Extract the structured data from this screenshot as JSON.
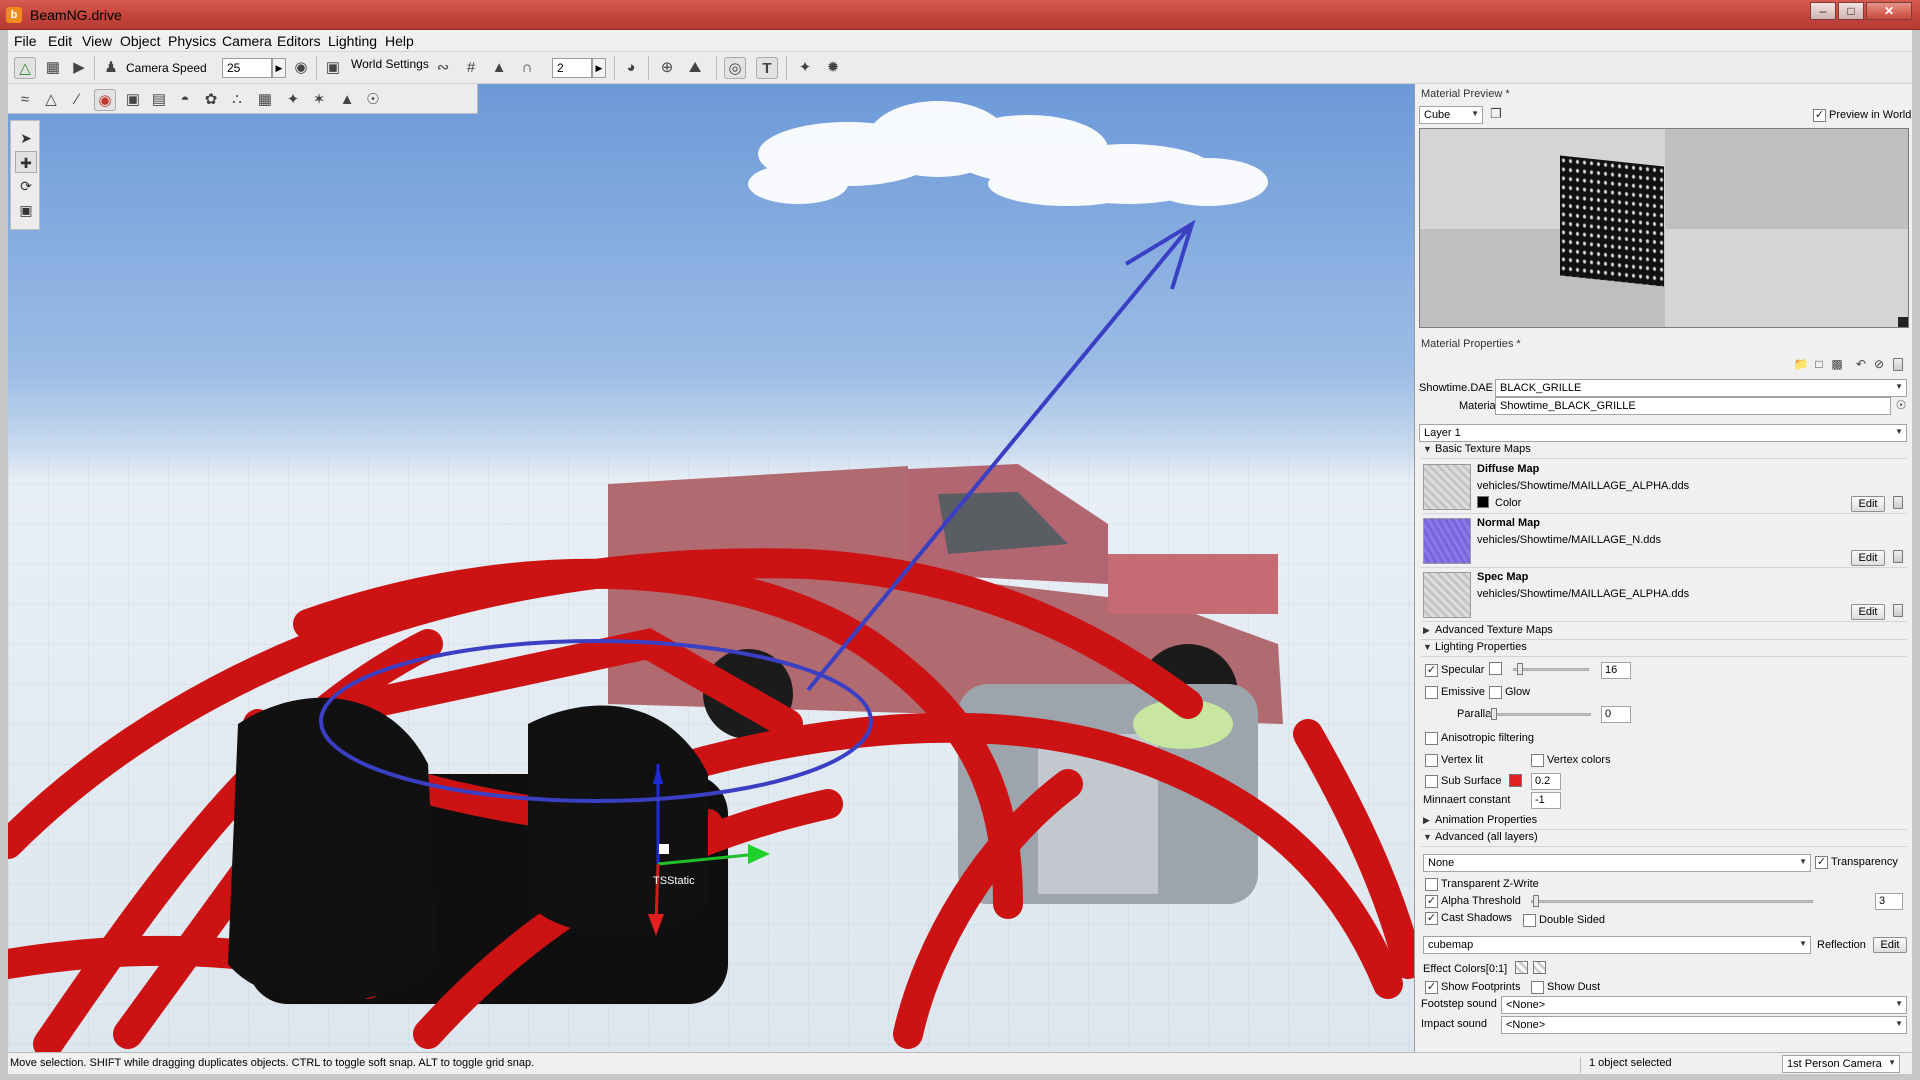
{
  "app": {
    "title": "BeamNG.drive"
  },
  "menu": [
    "File",
    "Edit",
    "View",
    "Object",
    "Physics",
    "Camera",
    "Editors",
    "Lighting",
    "Help"
  ],
  "toolbar": {
    "camera_speed_label": "Camera Speed",
    "camera_speed_value": "25",
    "world_settings_label": "World Settings",
    "snap_value": "2"
  },
  "viewport": {
    "object_label": "TSStatic",
    "annotation_color": "#3a3fc4"
  },
  "material_preview": {
    "title": "Material Preview *",
    "shape": "Cube",
    "preview_in_world_label": "Preview in World",
    "preview_in_world_checked": true
  },
  "material_properties": {
    "title": "Material Properties *",
    "mesh_label": "Showtime.DAE",
    "mesh_value": "BLACK_GRILLE",
    "material_label": "Material",
    "material_value": "Showtime_BLACK_GRILLE",
    "layer": "Layer 1",
    "basic_maps_header": "Basic Texture Maps",
    "texture_maps": [
      {
        "title": "Diffuse Map",
        "path": "vehicles/Showtime/MAILLAGE_ALPHA.dds",
        "extra": "Color",
        "edit": "Edit"
      },
      {
        "title": "Normal Map",
        "path": "vehicles/Showtime/MAILLAGE_N.dds",
        "extra": "",
        "edit": "Edit"
      },
      {
        "title": "Spec Map",
        "path": "vehicles/Showtime/MAILLAGE_ALPHA.dds",
        "extra": "",
        "edit": "Edit"
      }
    ],
    "advanced_maps_header": "Advanced Texture Maps",
    "lighting_header": "Lighting Properties",
    "specular_label": "Specular",
    "specular_checked": true,
    "specular_value": "16",
    "emissive_label": "Emissive",
    "glow_label": "Glow",
    "parallax_label": "Parallax",
    "parallax_value": "0",
    "anisotropic_label": "Anisotropic filtering",
    "vertex_lit_label": "Vertex lit",
    "vertex_colors_label": "Vertex colors",
    "sub_surface_label": "Sub Surface",
    "sub_surface_color": "#e02020",
    "sub_surface_value": "0.2",
    "minnaert_label": "Minnaert constant",
    "minnaert_value": "-1",
    "animation_header": "Animation Properties",
    "advanced_header": "Advanced (all layers)",
    "blend_value": "None",
    "transparency_label": "Transparency",
    "transparency_checked": true,
    "transparent_zwrite_label": "Transparent Z-Write",
    "alpha_threshold_label": "Alpha Threshold",
    "alpha_threshold_checked": true,
    "alpha_threshold_value": "3",
    "cast_shadows_label": "Cast Shadows",
    "cast_shadows_checked": true,
    "double_sided_label": "Double Sided",
    "cubemap_value": "cubemap",
    "reflection_label": "Reflection",
    "reflection_edit": "Edit",
    "effect_colors_label": "Effect Colors[0:1]",
    "show_footprints_label": "Show Footprints",
    "show_footprints_checked": true,
    "show_dust_label": "Show Dust",
    "footstep_sound_label": "Footstep sound",
    "footstep_sound_value": "<None>",
    "impact_sound_label": "Impact sound",
    "impact_sound_value": "<None>"
  },
  "status": {
    "hint": "Move selection.  SHIFT while dragging duplicates objects.  CTRL to toggle soft snap.  ALT to toggle grid snap.",
    "selection": "1 object selected",
    "camera": "1st Person Camera"
  }
}
